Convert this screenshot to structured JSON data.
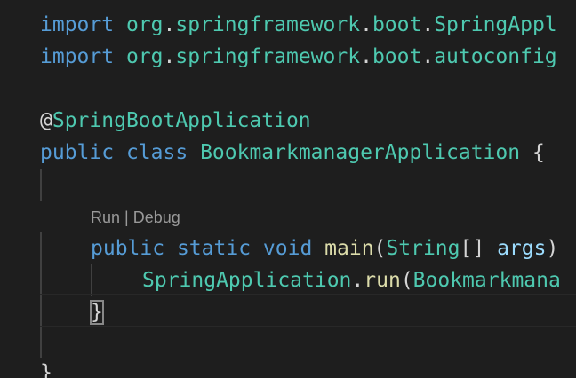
{
  "editor": {
    "line1": {
      "kw": "import",
      "t1": "org",
      "d1": ".",
      "t2": "springframework",
      "d2": ".",
      "t3": "boot",
      "d3": ".",
      "t4": "SpringAppl"
    },
    "line2": {
      "kw": "import",
      "t1": "org",
      "d1": ".",
      "t2": "springframework",
      "d2": ".",
      "t3": "boot",
      "d3": ".",
      "t4": "autoconfig"
    },
    "line4": {
      "at": "@",
      "name": "SpringBootApplication"
    },
    "line5": {
      "kw1": "public",
      "kw2": "class",
      "name": "BookmarkmanagerApplication",
      "brace": "{"
    },
    "codelens": {
      "run": "Run",
      "sep": " | ",
      "debug": "Debug"
    },
    "line7": {
      "kw1": "public",
      "kw2": "static",
      "kw3": "void",
      "fn": "main",
      "p1": "(",
      "type": "String",
      "arr": "[]",
      "arg": "args",
      "p2": ")"
    },
    "line8": {
      "cls": "SpringApplication",
      "dot": ".",
      "fn": "run",
      "p1": "(",
      "arg": "Bookmarkmana"
    },
    "line9": {
      "brace": "}"
    },
    "line11": {
      "brace": "}"
    }
  },
  "colors": {
    "background": "#1e1e1e",
    "keyword": "#569cd6",
    "type": "#4ec9b0",
    "function": "#dcdcaa",
    "variable": "#9cdcfe",
    "plain": "#d4d4d4",
    "codelens": "#999999"
  }
}
